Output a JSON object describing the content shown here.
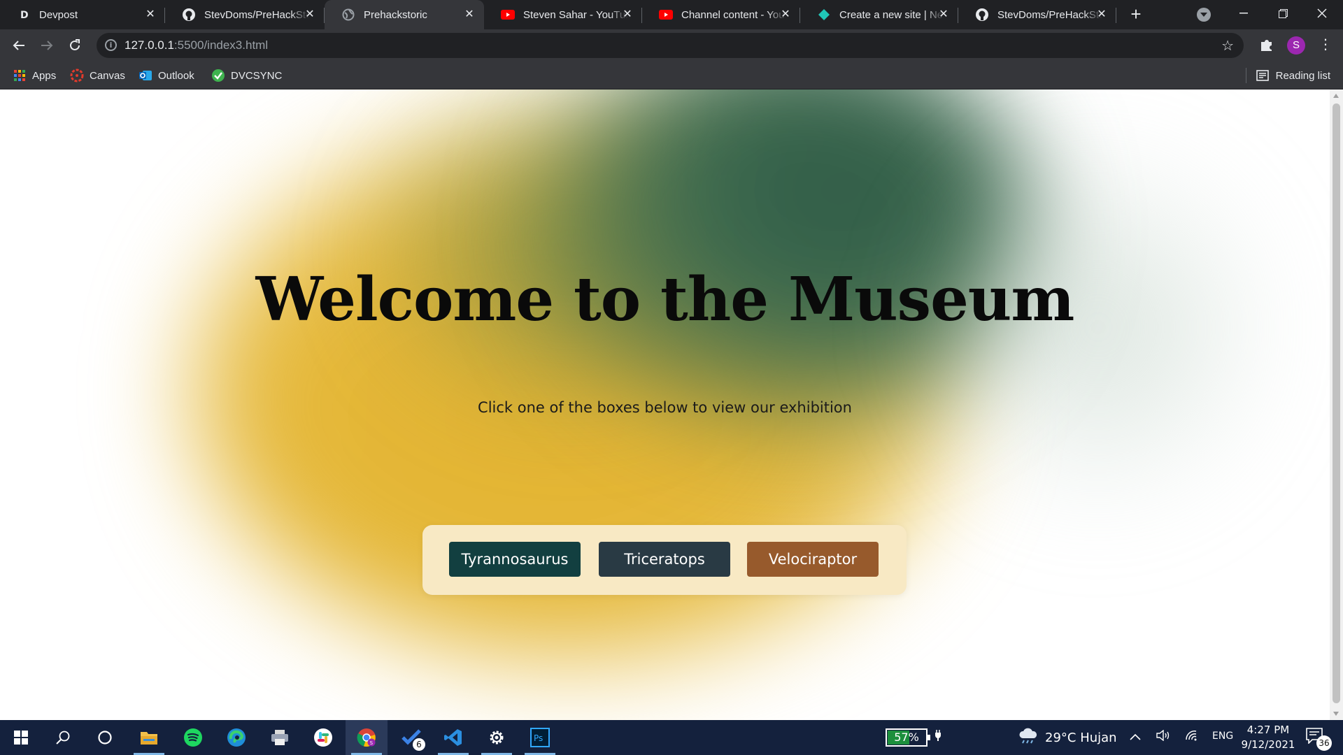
{
  "browser": {
    "tabs": [
      {
        "title": "Devpost",
        "icon": "devpost-icon",
        "active": false
      },
      {
        "title": "StevDoms/PreHackStoric",
        "icon": "github-icon",
        "active": false
      },
      {
        "title": "Prehackstoric",
        "icon": "globe-icon",
        "active": true
      },
      {
        "title": "Steven Sahar - YouTube",
        "icon": "youtube-icon",
        "active": false
      },
      {
        "title": "Channel content - YouTube",
        "icon": "youtube-icon",
        "active": false
      },
      {
        "title": "Create a new site | Netlify",
        "icon": "netlify-icon",
        "active": false
      },
      {
        "title": "StevDoms/PreHackStoric",
        "icon": "github-icon",
        "active": false
      }
    ],
    "address": {
      "host": "127.0.0.1",
      "path": ":5500/index3.html"
    },
    "profile_initial": "S",
    "bookmarks": [
      {
        "label": "Apps",
        "icon": "apps-grid-icon"
      },
      {
        "label": "Canvas",
        "icon": "canvas-icon"
      },
      {
        "label": "Outlook",
        "icon": "outlook-icon"
      },
      {
        "label": "DVCSYNC",
        "icon": "dvcsync-icon"
      }
    ],
    "reading_list_label": "Reading list"
  },
  "page": {
    "heading": "Welcome to the Museum",
    "subtitle": "Click one of the boxes below to view our exhibition",
    "exhibits": [
      {
        "label": "Tyrannosaurus",
        "color": "#123f40"
      },
      {
        "label": "Triceratops",
        "color": "#293a44"
      },
      {
        "label": "Velociraptor",
        "color": "#975a2c"
      }
    ]
  },
  "taskbar": {
    "apps": [
      "windows-start-icon",
      "search-icon",
      "task-view-icon",
      "file-explorer-icon",
      "spotify-icon",
      "edge-icon",
      "printer-app-icon",
      "slack-icon",
      "chrome-icon",
      "todo-icon",
      "vscode-icon",
      "settings-icon",
      "photoshop-icon"
    ],
    "todo_badge": "6",
    "battery_percent": "57%",
    "battery_level": 0.57,
    "weather": "29°C  Hujan",
    "language": "ENG",
    "time": "4:27 PM",
    "date": "9/12/2021",
    "notifications": "36"
  }
}
